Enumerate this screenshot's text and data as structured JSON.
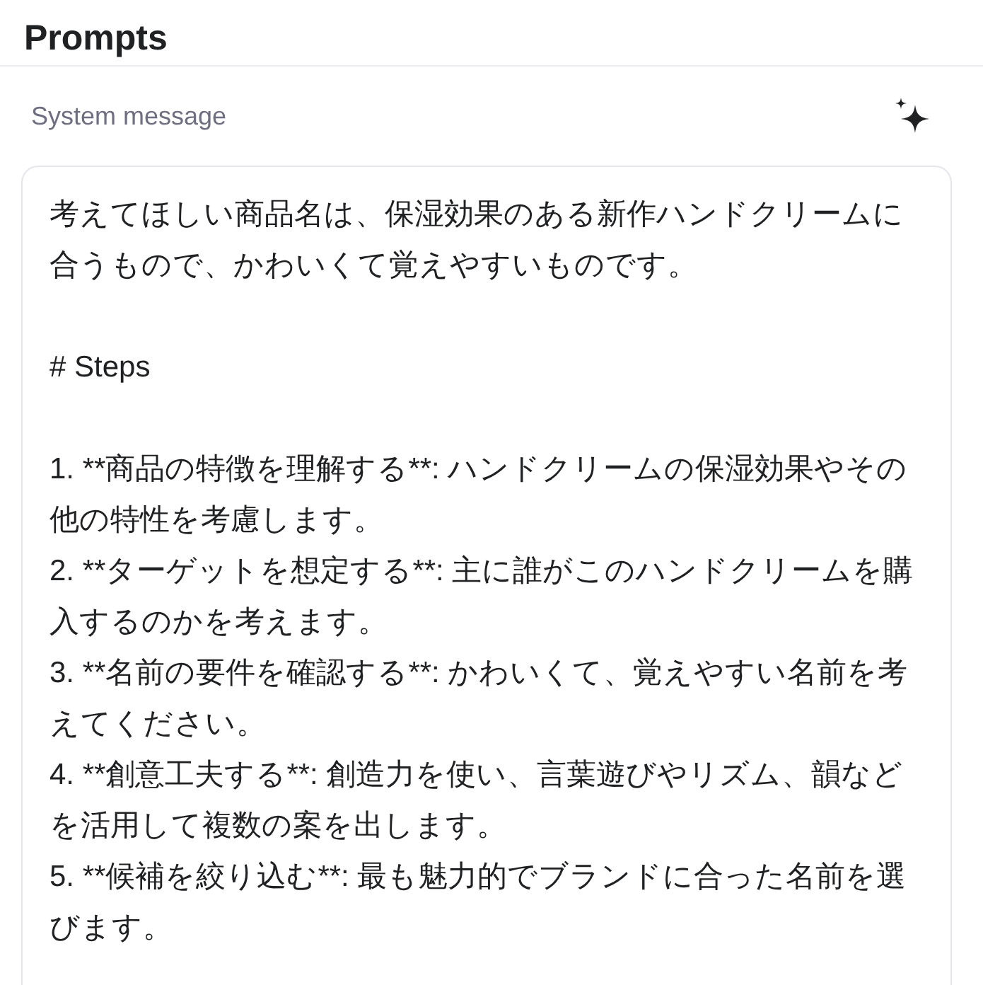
{
  "header": {
    "title": "Prompts"
  },
  "system_message": {
    "label": "System message",
    "blocks": [
      {
        "kind": "paragraph",
        "text": "考えてほしい商品名は、保湿効果のある新作ハンドクリームに合うもので、かわいくて覚えやすいものです。"
      },
      {
        "kind": "heading",
        "text": "# Steps"
      },
      {
        "kind": "item",
        "text": "1. **商品の特徴を理解する**: ハンドクリームの保湿効果やその他の特性を考慮します。"
      },
      {
        "kind": "item",
        "text": "2. **ターゲットを想定する**: 主に誰がこのハンドクリームを購入するのかを考えます。"
      },
      {
        "kind": "item",
        "text": "3. **名前の要件を確認する**: かわいくて、覚えやすい名前を考えてください。"
      },
      {
        "kind": "item",
        "text": "4. **創意工夫する**: 創造力を使い、言葉遊びやリズム、韻などを活用して複数の案を出します。"
      },
      {
        "kind": "item",
        "text": "5. **候補を絞り込む**: 最も魅力的でブランドに合った名前を選びます。"
      }
    ]
  }
}
